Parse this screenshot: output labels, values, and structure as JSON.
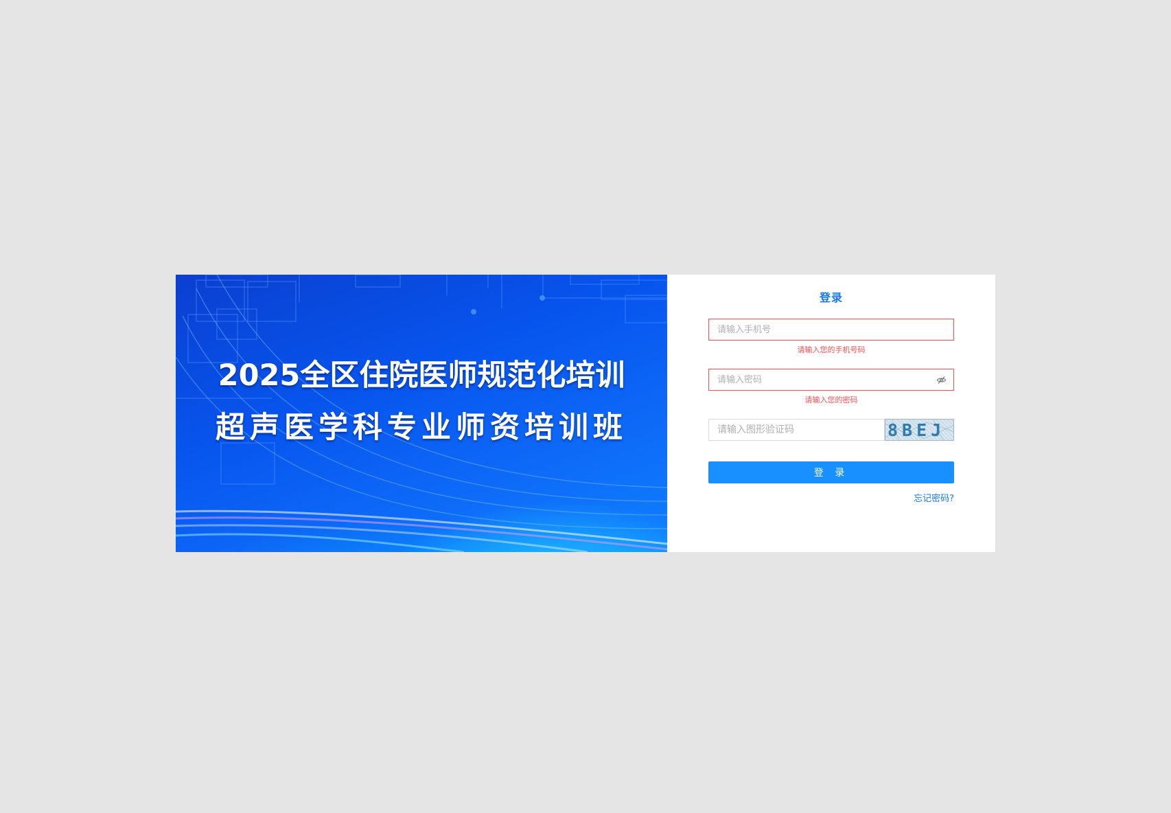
{
  "banner": {
    "title_line1": "2025全区住院医师规范化培训",
    "title_line2": "超声医学科专业师资培训班"
  },
  "login": {
    "title": "登录",
    "phone": {
      "placeholder": "请输入手机号",
      "value": "",
      "error": "请输入您的手机号码"
    },
    "password": {
      "placeholder": "请输入密码",
      "value": "",
      "error": "请输入您的密码",
      "toggle_icon": "eye-off-icon"
    },
    "captcha": {
      "placeholder": "请输入图形验证码",
      "value": "",
      "image_text": "8BEJ"
    },
    "submit_label": "登 录",
    "forgot_label": "忘记密码?"
  },
  "colors": {
    "background": "#e5e5e6",
    "primary": "#1890ff",
    "title_blue": "#1677ff",
    "error": "#ff4d4f",
    "banner_blue": "#0755ee"
  }
}
